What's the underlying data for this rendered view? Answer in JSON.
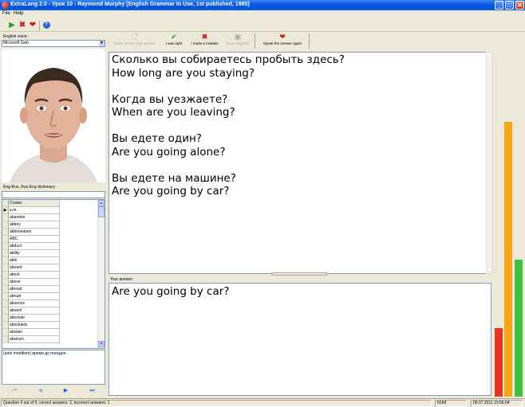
{
  "window": {
    "title": "ExtraLang 2.0 - Урок 10 - Raymond Murphy [English Grammar In Use, 1st published, 1985]"
  },
  "menu": [
    "File",
    "Help"
  ],
  "left": {
    "voice_label": "English voice:",
    "voice_value": "Microsoft Sam",
    "dictionary_label": "Eng-Rus, Rus-Eng dictionary:",
    "dictionary_header": "Слово:",
    "dictionary_words": [
      "a.m.",
      "abandon",
      "abbey",
      "abbreviation",
      "ABC",
      "abduct",
      "ability",
      "able",
      "aboard",
      "about",
      "above",
      "abroad",
      "abrupt",
      "absence",
      "absent",
      "absolute",
      "absolutely",
      "abstain",
      "abstract"
    ],
    "translation_text": "(ante meridiem) время до полудня"
  },
  "toolbar": {
    "show_right_answer": "Show me the right answer",
    "i_was_right": "I was right",
    "i_made_mistake": "I made a mistake",
    "save_progress": "Save progress",
    "speak_again": "Speak the answer again"
  },
  "question": {
    "lines": [
      "Сколько вы собираетесь пробыть здесь?",
      "How long are you staying?",
      "",
      "Когда вы уезжаете?",
      "When are you leaving?",
      "",
      "Вы едете один?",
      "Are you going alone?",
      "",
      "Вы едете на машине?",
      "Are you going by car?"
    ]
  },
  "answer": {
    "label": "Your answer:",
    "text": "Are you going by car?"
  },
  "progress": {
    "bars": [
      {
        "name": "incorrect",
        "color": "#e8331e",
        "level": 0.2
      },
      {
        "name": "total",
        "color": "#f7a511",
        "level": 0.8
      },
      {
        "name": "correct",
        "color": "#3fc23f",
        "level": 0.4
      }
    ]
  },
  "status": {
    "text": "Question 4 out of 5; correct answers: 2, incorrect answers: 1",
    "num": "NUM",
    "datetime": "09.07.2011 15:56:04"
  },
  "icons": {
    "play": "play-icon",
    "stop": "stop-icon",
    "heart": "heart-icon",
    "help": "help-icon"
  }
}
